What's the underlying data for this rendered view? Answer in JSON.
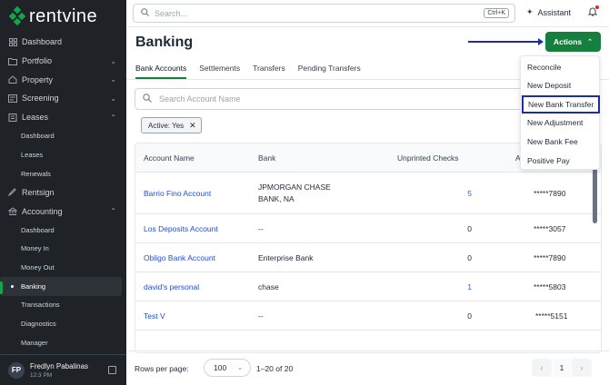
{
  "app": {
    "logo_text": "rentvine"
  },
  "sidebar": {
    "items": [
      {
        "label": "Dashboard",
        "icon": "dashboard-icon",
        "chevron": ""
      },
      {
        "label": "Portfolio",
        "icon": "folder-icon",
        "chevron": "⌄"
      },
      {
        "label": "Property",
        "icon": "home-icon",
        "chevron": "⌄"
      },
      {
        "label": "Screening",
        "icon": "screening-icon",
        "chevron": "⌄"
      },
      {
        "label": "Leases",
        "icon": "leases-icon",
        "chevron": "⌃"
      }
    ],
    "lease_subitems": [
      "Dashboard",
      "Leases",
      "Renewals"
    ],
    "rentsign": {
      "label": "Rentsign",
      "icon": "rentsign-icon"
    },
    "accounting": {
      "label": "Accounting",
      "icon": "accounting-icon",
      "chevron": "⌃"
    },
    "accounting_subitems": [
      "Dashboard",
      "Money In",
      "Money Out",
      "Banking",
      "Transactions",
      "Diagnostics",
      "Manager"
    ],
    "active_subitem": "Banking",
    "accent": "#16a34a"
  },
  "user": {
    "initials": "FP",
    "name": "Fredlyn Pabalinas",
    "time": "12:3 PM"
  },
  "topbar": {
    "search_placeholder": "Search...",
    "shortcut": "Ctrl+K",
    "assistant_label": "Assistant"
  },
  "page": {
    "title": "Banking",
    "actions_label": "Actions",
    "tabs": [
      "Bank Accounts",
      "Settlements",
      "Transfers",
      "Pending Transfers"
    ],
    "active_tab": "Bank Accounts",
    "account_search_placeholder": "Search Account Name",
    "filter_chip": "Active: Yes"
  },
  "table": {
    "columns": [
      "Account Name",
      "Bank",
      "Unprinted Checks",
      "A"
    ],
    "rows": [
      {
        "name": "Barrio Fino Account",
        "bank_line1": "JPMORGAN CHASE",
        "bank_line2": "BANK, NA",
        "checks": "5",
        "account": "*****7890"
      },
      {
        "name": "Los Deposits Account",
        "bank_line1": "--",
        "bank_line2": "",
        "checks": "0",
        "account": "*****3057"
      },
      {
        "name": "Obligo Bank Account",
        "bank_line1": "Enterprise Bank",
        "bank_line2": "",
        "checks": "0",
        "account": "*****7890"
      },
      {
        "name": "david's personal",
        "bank_line1": "chase",
        "bank_line2": "",
        "checks": "1",
        "account": "*****5803"
      },
      {
        "name": "Test V",
        "bank_line1": "--",
        "bank_line2": "",
        "checks": "0",
        "account": "*****5151"
      }
    ]
  },
  "pagination": {
    "rows_per_page_label": "Rows per page:",
    "rows_per_page": "100",
    "range": "1–20 of 20",
    "page": "1"
  },
  "actions_menu": {
    "items": [
      "Reconcile",
      "New Deposit",
      "New Bank Transfer",
      "New Adjustment",
      "New Bank Fee",
      "Positive Pay"
    ],
    "highlighted": "New Bank Transfer"
  },
  "colors": {
    "primary_green": "#15803d",
    "link_blue": "#1d4ed8",
    "annotation_blue": "#1e2ea0"
  }
}
